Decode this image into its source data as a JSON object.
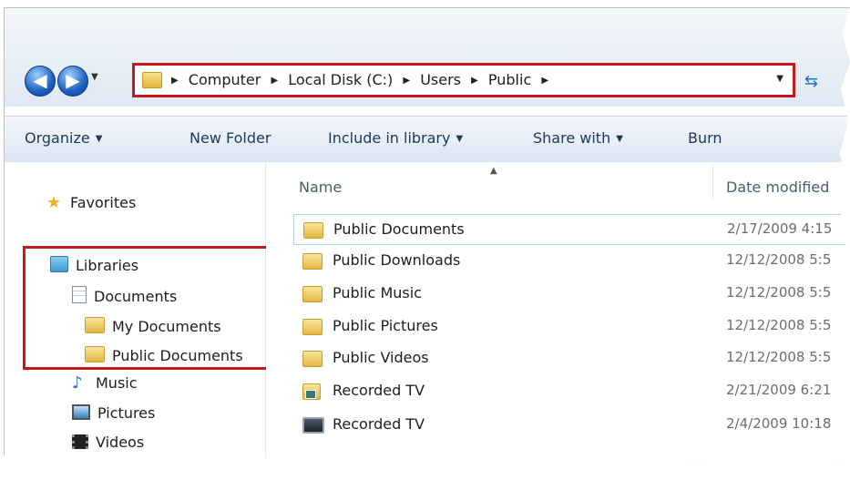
{
  "address_bar": {
    "crumbs": [
      "Computer",
      "Local Disk (C:)",
      "Users",
      "Public"
    ]
  },
  "toolbar": {
    "organize": "Organize",
    "new_folder": "New Folder",
    "include_in_library": "Include in library",
    "share_with": "Share with",
    "burn": "Burn"
  },
  "nav_pane": {
    "favorites": "Favorites",
    "libraries": "Libraries",
    "documents": "Documents",
    "my_documents": "My Documents",
    "public_documents": "Public Documents",
    "music": "Music",
    "pictures": "Pictures",
    "videos": "Videos"
  },
  "columns": {
    "name": "Name",
    "date_modified": "Date modified"
  },
  "files": [
    {
      "name": "Public Documents",
      "date": "2/17/2009 4:15",
      "icon": "folder-icon"
    },
    {
      "name": "Public Downloads",
      "date": "12/12/2008 5:5",
      "icon": "folder-icon"
    },
    {
      "name": "Public Music",
      "date": "12/12/2008 5:5",
      "icon": "folder-icon"
    },
    {
      "name": "Public Pictures",
      "date": "12/12/2008 5:5",
      "icon": "folder-icon"
    },
    {
      "name": "Public Videos",
      "date": "12/12/2008 5:5",
      "icon": "folder-icon"
    },
    {
      "name": "Recorded TV",
      "date": "2/21/2009 6:21",
      "icon": "recorded-tv-folder-icon"
    },
    {
      "name": "Recorded TV",
      "date": "2/4/2009 10:18",
      "icon": "recorded-tv-library-icon"
    }
  ],
  "colors": {
    "highlight_box": "#c4191f",
    "toolbar_text": "#1e395b",
    "date_text": "#6d6d6d"
  }
}
